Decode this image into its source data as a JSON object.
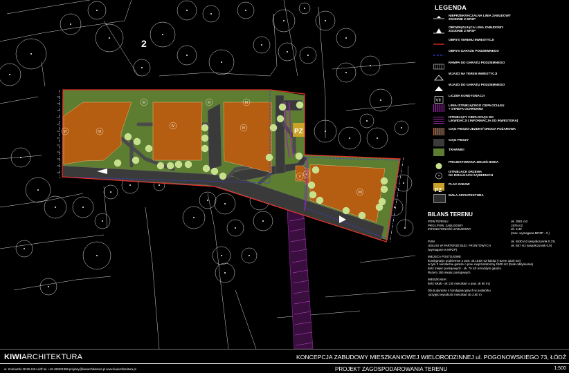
{
  "plan": {
    "plot_number": "2",
    "storeys": [
      "III",
      "III",
      "III",
      "IV",
      "VI",
      "VI",
      "IV",
      "V",
      "V",
      "VII"
    ],
    "playground": "PZ",
    "colors": {
      "building": "#b55d10",
      "lawn": "#5d7d31",
      "road": "#3a3a3a",
      "boundary": "#e4312b",
      "garage": "#3a3fcf",
      "pipe": "#9b27a8",
      "tree_fill": "#c7e08a"
    }
  },
  "legend": {
    "title": "LEGENDA",
    "items": [
      {
        "icon": "fixed-building-line-icon",
        "label": "NIEPRZEKRACZALNA LINIA ZABUDOWY\nZGODNIE Z MPZP"
      },
      {
        "icon": "mandatory-building-line-icon",
        "label": "OBOWIĄZUJĄCA LINIA ZABUDOWY\nZGODNIE Z MPZP"
      },
      {
        "icon": "site-boundary-icon",
        "label": "OBRYS TERENU INWESTYCJI"
      },
      {
        "icon": "underground-garage-icon",
        "label": "OBRYS GARAŻU PODZIEMNEGO"
      },
      {
        "icon": "garage-ramp-icon",
        "label": "RAMPA DO GARAŻU PODZIEMNEGO"
      },
      {
        "icon": "site-entrance-icon",
        "label": "WJAZD NA TEREN INWESTYCJI"
      },
      {
        "icon": "garage-entrance-icon",
        "label": "WJAZD DO GARAŻU PODZIEMNEGO"
      },
      {
        "icon": "storeys-icon",
        "label": "LICZBA KONDYGNACJI"
      },
      {
        "icon": "heat-pipe-icon",
        "label": "LINIA ISTNIEJĄCEGO CIEPŁOCIĄGU\n+ STREFA OCHRONNA"
      },
      {
        "icon": "pipe-removal-icon",
        "label": "ISTNIEJĄCY CIEPŁOCIĄG DO\nLIKWIDACJI ( INFORMACJA OD INWESTORA)"
      },
      {
        "icon": "fire-road-icon",
        "label": "CIĄG PIESZO-JEZDNY/ DROGA POŻAROWA"
      },
      {
        "icon": "footpath-icon",
        "label": "CIĄG PIESZY"
      },
      {
        "icon": "lawn-icon",
        "label": "TRAWNIKI"
      },
      {
        "icon": "low-greenery-icon",
        "label": "PROJEKTOWANA ZIELEŃ NISKA"
      },
      {
        "icon": "existing-tree-icon",
        "label": "ISTNIEJĄCE DRZEWA\nNA DZIAŁKACH SĄSIEDNICH"
      },
      {
        "icon": "playground-icon",
        "label": "PLAC ZABAW"
      },
      {
        "icon": "small-architecture-icon",
        "label": "MAŁA ARCHITEKTURA"
      }
    ],
    "pz_text": "PZ",
    "storeys_text": "VII"
  },
  "bilans": {
    "title": "BILANS TERENU",
    "rows": [
      {
        "k": "POW.TERENU",
        "v": "ok. 3801 m2"
      },
      {
        "k": "PROJ.POW. ZABUDOWY",
        "v": "1976 m2"
      },
      {
        "k": "INTENSYWNOŚĆ ZABUDOWY",
        "v": "ok.   2,30"
      },
      {
        "k": "",
        "v": "(max. wymagana MPZP - 3 )"
      },
      {
        "k": "PUM",
        "v": "ok. 6530 m2 (współczynnik 0,72)"
      },
      {
        "k": "USŁUGI W PARTERZE BUD. FRONTOWYCH",
        "v": "ok.  657 m2 (współczynnik 0,9)"
      },
      {
        "k": "(wymagane w MPZP)",
        "v": ""
      }
    ],
    "parking_title": "MIEJSCA POSTOJOWE",
    "parking_text": "kondygnacje podziemne o pow. ok.1610 m2 każda ( razem 3220 m2)\nw tym 2 niezależne garaże o pow. nieprzelotniczej 1500 m2 (brak oddymiania)\nilość miejsc postojowych - ok. 75 szt w każdym garażu.\nRazem 150 miejsc postojowych",
    "flats_title": "MIESZKANIA:",
    "flats_text": "ilość lokali - ok 130 mieszkań o pow. ok 50 m2",
    "floors_text": "Dla budynków 4 kondygnacyjnych w podwórku\n-przyjęto wysokość mieszkań do 2,60 m"
  },
  "footer": {
    "brand_a": "KIWI",
    "brand_b": "ARCHITEKTURA",
    "title": "KONCEPCJA ZABUDOWY MIESZKANIOWEJ WIELORODZINNEJ  ul. POGONOWSKIEGO 73, ŁÓDŹ",
    "contact": "ul. Kościuszki 28 90-419 Łódź     tel. +48 426321999     projekty@kiwiarchitektura.pl     www.kiwiarchitektura.pl",
    "subtitle": "PROJEKT ZAGOSPODAROWANIA TERENU",
    "scale": "1:500"
  }
}
